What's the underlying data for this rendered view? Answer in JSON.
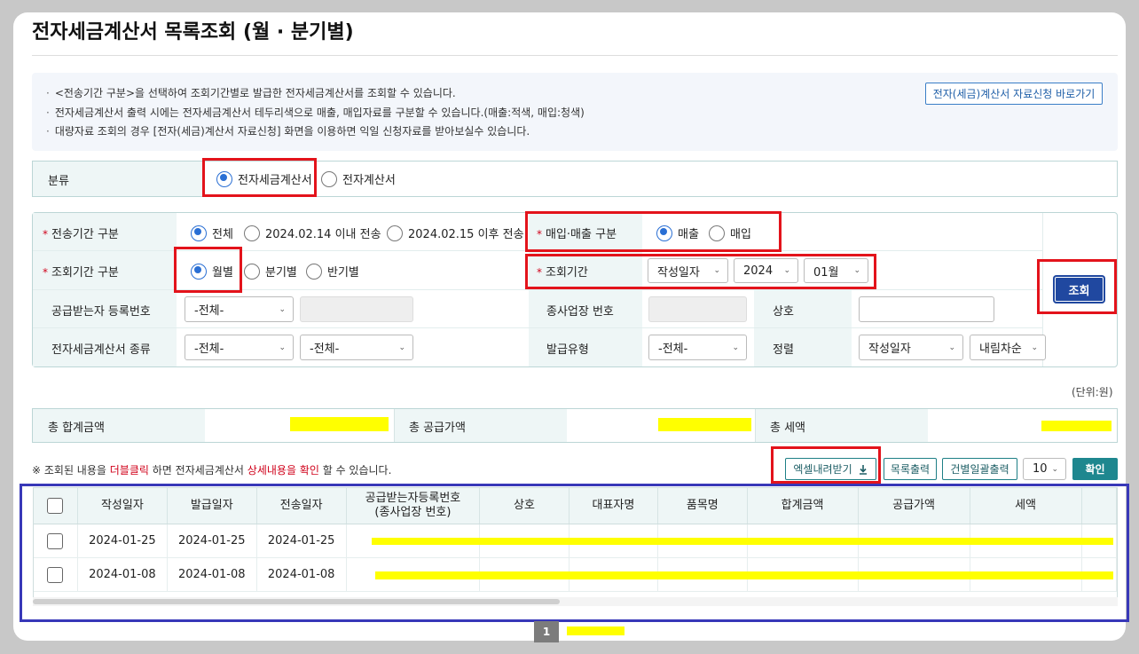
{
  "page": {
    "title": "전자세금계산서 목록조회 (월 · 분기별)"
  },
  "info": {
    "lines": [
      "<전송기간 구분>을 선택하여 조회기간별로 발급한 전자세금계산서를 조회할 수 있습니다.",
      "전자세금계산서 출력 시에는 전자세금계산서 테두리색으로 매출, 매입자료를 구분할 수 있습니다.(매출:적색, 매입:청색)",
      "대량자료 조회의 경우 [전자(세금)계산서 자료신청] 화면을 이용하면 익일 신청자료를 받아보실수 있습니다."
    ],
    "link_label": "전자(세금)계산서 자료신청 바로가기"
  },
  "category": {
    "label": "분류",
    "options": [
      "전자세금계산서",
      "전자계산서"
    ],
    "selected": "전자세금계산서"
  },
  "filters": {
    "send_period": {
      "label": "전송기간 구분",
      "options": [
        "전체",
        "2024.02.14 이내 전송",
        "2024.02.15 이후 전송"
      ],
      "selected": "전체"
    },
    "trade_type": {
      "label": "매입·매출 구분",
      "options": [
        "매출",
        "매입"
      ],
      "selected": "매출"
    },
    "query_period_type": {
      "label": "조회기간 구분",
      "options": [
        "월별",
        "분기별",
        "반기별"
      ],
      "selected": "월별"
    },
    "query_period": {
      "label": "조회기간",
      "date_basis": "작성일자",
      "year": "2024",
      "month": "01월"
    },
    "receiver_reg_no": {
      "label": "공급받는자 등록번호",
      "select": "-전체-"
    },
    "branch_no": {
      "label": "종사업장 번호"
    },
    "company_name": {
      "label": "상호"
    },
    "invoice_kind": {
      "label": "전자세금계산서 종류",
      "select1": "-전체-",
      "select2": "-전체-"
    },
    "issue_type": {
      "label": "발급유형",
      "select": "-전체-"
    },
    "sort": {
      "label": "정렬",
      "field": "작성일자",
      "order": "내림차순"
    },
    "search_label": "조회"
  },
  "unit_label": "(단위:원)",
  "totals": {
    "total_sum_label": "총 합계금액",
    "supply_label": "총 공급가액",
    "tax_label": "총 세액"
  },
  "notice": {
    "prefix": "※ 조회된 내용을",
    "dblclick": "더블클릭",
    "middle": "하면 전자세금계산서",
    "detail": "상세내용을 확인",
    "suffix": "할 수 있습니다."
  },
  "toolbar": {
    "excel_label": "엑셀내려받기",
    "list_print_label": "목록출력",
    "bulk_print_label": "건별일괄출력",
    "page_size": "10",
    "confirm_label": "확인"
  },
  "table": {
    "columns": [
      "작성일자",
      "발급일자",
      "전송일자",
      "공급받는자등록번호\n(종사업장 번호)",
      "상호",
      "대표자명",
      "품목명",
      "합계금액",
      "공급가액",
      "세액"
    ],
    "rows": [
      {
        "written": "2024-01-25",
        "issued": "2024-01-25",
        "sent": "2024-01-25"
      },
      {
        "written": "2024-01-08",
        "issued": "2024-01-08",
        "sent": "2024-01-08"
      }
    ]
  },
  "pagination": {
    "current": "1"
  },
  "colors": {
    "accent_red": "#e3131b",
    "table_frame_blue": "#3838b8",
    "search_button": "#2048a0",
    "teal": "#1e878f",
    "highlight": "#ffff00"
  },
  "icons": {
    "download": "download-icon",
    "chevron": "chevron-down-icon"
  }
}
